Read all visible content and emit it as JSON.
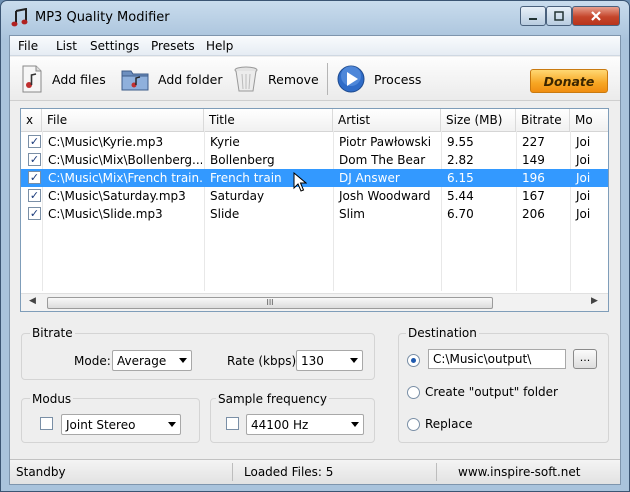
{
  "window": {
    "title": "MP3 Quality Modifier"
  },
  "menu": [
    "File",
    "List",
    "Settings",
    "Presets",
    "Help"
  ],
  "toolbar": {
    "add_files": "Add files",
    "add_folder": "Add folder",
    "remove": "Remove",
    "process": "Process",
    "donate": "Donate"
  },
  "table": {
    "columns": [
      "x",
      "File",
      "Title",
      "Artist",
      "Size  (MB)",
      "Bitrate",
      "Mo"
    ],
    "rows": [
      {
        "checked": true,
        "file": "C:\\Music\\Kyrie.mp3",
        "title": "Kyrie",
        "artist": "Piotr Pawłowski",
        "size": "9.55",
        "bitrate": "227",
        "mode": "Joi"
      },
      {
        "checked": true,
        "file": "C:\\Music\\Mix\\Bollenberg....",
        "title": "Bollenberg",
        "artist": "Dom The Bear",
        "size": "2.82",
        "bitrate": "149",
        "mode": "Joi"
      },
      {
        "checked": true,
        "file": "C:\\Music\\Mix\\French train....",
        "title": "French train",
        "artist": "DJ Answer",
        "size": "6.15",
        "bitrate": "196",
        "mode": "Joi"
      },
      {
        "checked": true,
        "file": "C:\\Music\\Saturday.mp3",
        "title": "Saturday",
        "artist": "Josh Woodward",
        "size": "5.44",
        "bitrate": "167",
        "mode": "Joi"
      },
      {
        "checked": true,
        "file": "C:\\Music\\Slide.mp3",
        "title": "Slide",
        "artist": "Slim",
        "size": "6.70",
        "bitrate": "206",
        "mode": "Joi"
      }
    ],
    "selected_row": 2,
    "scroll_grip": "III"
  },
  "bitrate": {
    "group_title": "Bitrate",
    "mode_label": "Mode:",
    "mode_value": "Average",
    "rate_label": "Rate (kbps):",
    "rate_value": "130"
  },
  "modus": {
    "group_title": "Modus",
    "value": "Joint Stereo"
  },
  "sample": {
    "group_title": "Sample frequency",
    "value": "44100 Hz"
  },
  "destination": {
    "group_title": "Destination",
    "path": "C:\\Music\\output\\",
    "browse": "...",
    "create_output": "Create \"output\" folder",
    "replace": "Replace"
  },
  "status": {
    "state": "Standby",
    "loaded": "Loaded Files: 5",
    "website": "www.inspire-soft.net"
  }
}
